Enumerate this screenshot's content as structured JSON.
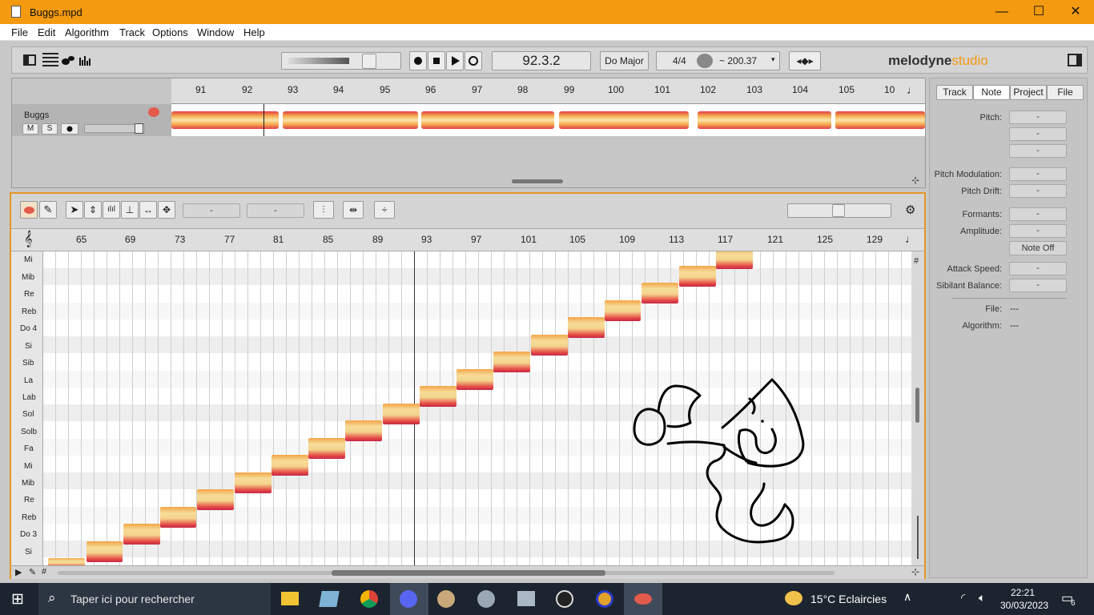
{
  "window": {
    "title": "Buggs.mpd",
    "minimize": "—",
    "maximize": "☐",
    "close": "✕"
  },
  "menu": [
    "File",
    "Edit",
    "Algorithm",
    "Track",
    "Options",
    "Window",
    "Help"
  ],
  "transport": {
    "position": "92.3.2",
    "key": "Do Major",
    "meter": "4/4",
    "tempo": "~ 200.37"
  },
  "brand": {
    "main": "melodyne",
    "sub": "studio"
  },
  "overview": {
    "bars": [
      "91",
      "92",
      "93",
      "94",
      "95",
      "96",
      "97",
      "98",
      "99",
      "100",
      "101",
      "102",
      "103",
      "104",
      "105",
      "10"
    ],
    "track": {
      "name": "Buggs",
      "mute": "M",
      "solo": "S"
    }
  },
  "editor": {
    "field1": "-",
    "field2": "-",
    "ruler": [
      "65",
      "69",
      "73",
      "77",
      "81",
      "85",
      "89",
      "93",
      "97",
      "101",
      "105",
      "109",
      "113",
      "117",
      "121",
      "125",
      "129"
    ],
    "pitches": [
      "Mi",
      "Mib",
      "Re",
      "Reb",
      "Do 4",
      "Si",
      "Sib",
      "La",
      "Lab",
      "Sol",
      "Solb",
      "Fa",
      "Mi",
      "Mib",
      "Re",
      "Reb",
      "Do 3",
      "Si"
    ]
  },
  "inspector": {
    "tabs": [
      "Track",
      "Note",
      "Project",
      "File"
    ],
    "active_tab": "Note",
    "rows": [
      {
        "label": "Pitch:",
        "value": "-"
      },
      {
        "label": "",
        "value": "-"
      },
      {
        "label": "",
        "value": "-"
      },
      {
        "label": "Pitch Modulation:",
        "value": "-"
      },
      {
        "label": "Pitch Drift:",
        "value": "-"
      },
      {
        "label": "Formants:",
        "value": "-"
      },
      {
        "label": "Amplitude:",
        "value": "-"
      },
      {
        "label": "",
        "value": "Note Off"
      },
      {
        "label": "Attack Speed:",
        "value": "-"
      },
      {
        "label": "Sibilant Balance:",
        "value": "-"
      }
    ],
    "file_label": "File:",
    "file_value": "---",
    "algo_label": "Algorithm:",
    "algo_value": "---"
  },
  "taskbar": {
    "search": "Taper ici pour rechercher",
    "weather": "15°C  Eclaircies",
    "time": "22:21",
    "date": "30/03/2023",
    "notif": "6"
  },
  "colors": {
    "titlebar": "#f39a10",
    "accent": "#e39624"
  }
}
